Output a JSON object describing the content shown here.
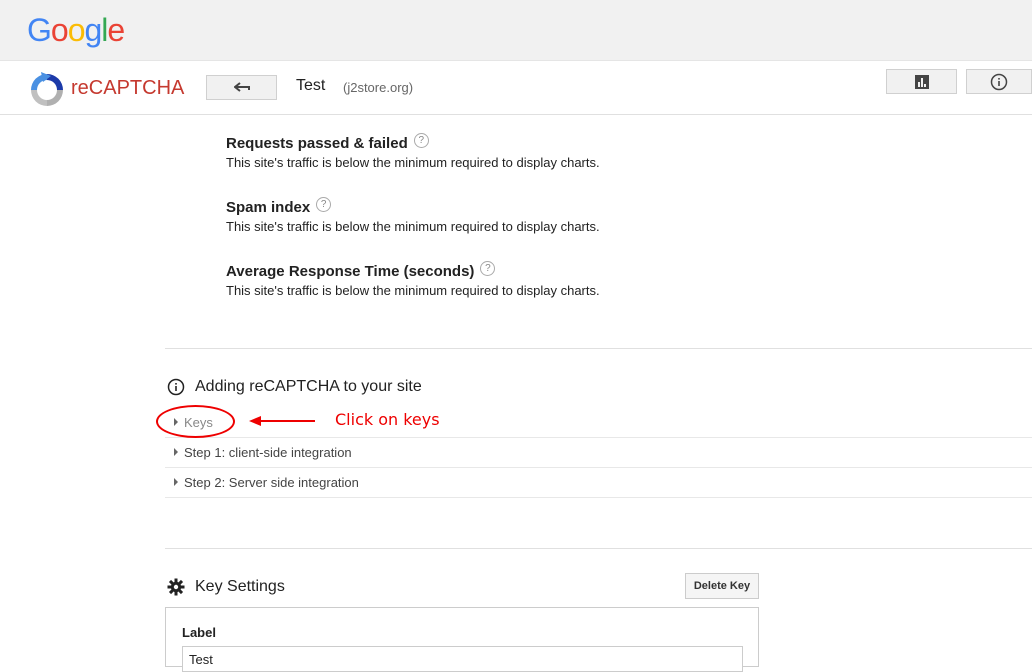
{
  "google_logo": {
    "letters": [
      {
        "ch": "G",
        "color": "#4285F4"
      },
      {
        "ch": "o",
        "color": "#EA4335"
      },
      {
        "ch": "o",
        "color": "#FBBC05"
      },
      {
        "ch": "g",
        "color": "#4285F4"
      },
      {
        "ch": "l",
        "color": "#34A853"
      },
      {
        "ch": "e",
        "color": "#EA4335"
      }
    ]
  },
  "header": {
    "product_title": "reCAPTCHA",
    "site_name": "Test",
    "site_domain": "(j2store.org)",
    "back_icon": "back-arrow-icon",
    "analytics_icon": "bar-chart-icon",
    "info_icon": "info-icon"
  },
  "stats": [
    {
      "title": "Requests passed & failed",
      "note": "This site's traffic is below the minimum required to display charts."
    },
    {
      "title": "Spam index",
      "note": "This site's traffic is below the minimum required to display charts."
    },
    {
      "title": "Average Response Time (seconds)",
      "note": "This site's traffic is below the minimum required to display charts."
    }
  ],
  "adding": {
    "title": "Adding reCAPTCHA to your site",
    "items": [
      "Keys",
      "Step 1: client-side integration",
      "Step 2: Server side integration"
    ]
  },
  "annotation": {
    "text": "Click on keys",
    "color": "#e00000"
  },
  "key_settings": {
    "title": "Key Settings",
    "delete_label": "Delete Key",
    "label_title": "Label",
    "label_value": "Test"
  }
}
